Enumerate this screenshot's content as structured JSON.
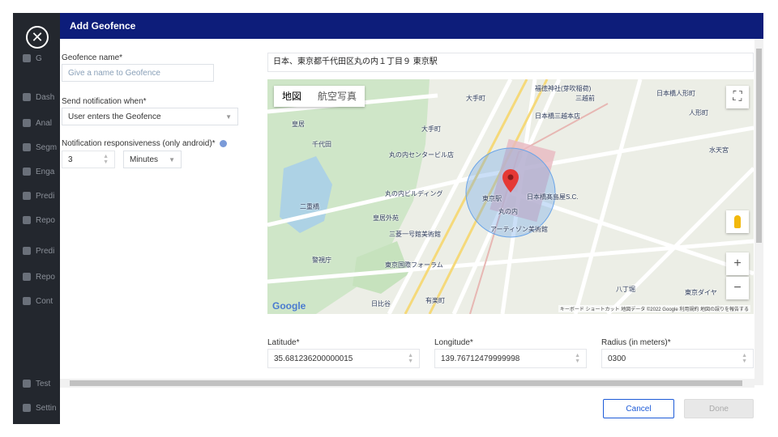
{
  "sidebar": {
    "items": [
      {
        "label": "G",
        "icon": "home-icon"
      },
      {
        "label": "Dash",
        "icon": "dashboard-icon"
      },
      {
        "label": "Anal",
        "icon": "bar-chart-icon"
      },
      {
        "label": "Segm",
        "icon": "pie-icon"
      },
      {
        "label": "Enga",
        "icon": "megaphone-icon"
      },
      {
        "label": "Predi",
        "icon": "prediction-icon"
      },
      {
        "label": "Repo",
        "icon": "report-icon"
      },
      {
        "label": "Predi",
        "icon": "prediction-icon"
      },
      {
        "label": "Repo",
        "icon": "report-icon"
      },
      {
        "label": "Cont",
        "icon": "content-icon"
      },
      {
        "label": "Test",
        "icon": "code-icon"
      },
      {
        "label": "Settin",
        "icon": "gear-icon"
      }
    ]
  },
  "modal": {
    "title": "Add Geofence",
    "close_symbol": "✕",
    "fields": {
      "geofence_name": {
        "label": "Geofence name*",
        "placeholder": "Give a name to Geofence",
        "value": ""
      },
      "send_notification": {
        "label": "Send notification when*",
        "value": "User enters the Geofence"
      },
      "responsiveness": {
        "label": "Notification responsiveness (only android)*",
        "value": "3",
        "unit": "Minutes"
      },
      "latitude": {
        "label": "Latitude*",
        "value": "35.681236200000015"
      },
      "longitude": {
        "label": "Longitude*",
        "value": "139.76712479999998"
      },
      "radius": {
        "label": "Radius (in meters)*",
        "value": "0300"
      }
    },
    "address": "日本、東京都千代田区丸の内１丁目９ 東京駅",
    "map": {
      "tab_map": "地図",
      "tab_satellite": "航空写真",
      "google_logo": "Google",
      "attribution": "キーボード ショートカット  地図データ ©2022 Google  利用規約  地図の誤りを報告する",
      "labels": [
        "大手町",
        "福徳神社(芽吹稲荷)",
        "三越前",
        "日本橋人形町",
        "日本橋三越本店",
        "人形町",
        "皇居",
        "千代田",
        "大手町",
        "丸の内センタービル店",
        "日本橋髙島屋S.C.",
        "水天宮",
        "二重橋",
        "皇居外苑",
        "丸の内ビルディング",
        "三菱一号館美術館",
        "東京駅",
        "丸の内",
        "アーティゾン美術館",
        "東京国際フォーラム",
        "八丁堀",
        "東京ダイヤ",
        "有楽町",
        "日比谷",
        "警視庁"
      ],
      "zoom_in": "+",
      "zoom_out": "−",
      "fullscreen": "⛶"
    },
    "buttons": {
      "cancel": "Cancel",
      "done": "Done"
    }
  }
}
